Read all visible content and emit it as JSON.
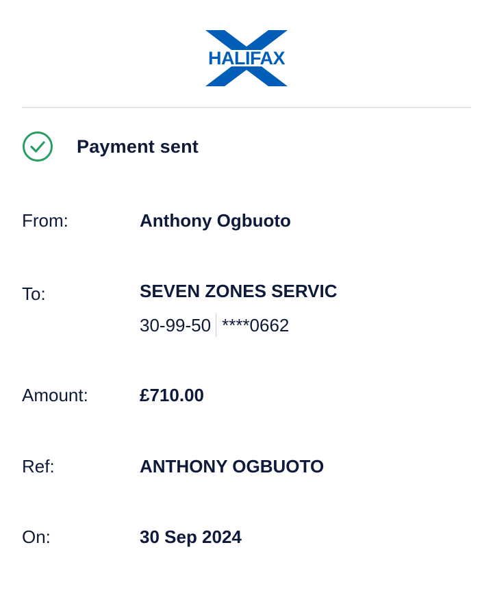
{
  "brand": {
    "name": "HALIFAX",
    "color": "#005eb8"
  },
  "status": {
    "text": "Payment sent",
    "icon": "check-circle-icon",
    "color": "#2a9d63"
  },
  "details": {
    "from": {
      "label": "From:",
      "value": "Anthony Ogbuoto"
    },
    "to": {
      "label": "To:",
      "value": "SEVEN ZONES SERVIC",
      "sort_code": "30-99-50",
      "account_number": "****0662"
    },
    "amount": {
      "label": "Amount:",
      "value": "£710.00"
    },
    "ref": {
      "label": "Ref:",
      "value": "ANTHONY OGBUOTO"
    },
    "on": {
      "label": "On:",
      "value": "30 Sep 2024"
    }
  }
}
